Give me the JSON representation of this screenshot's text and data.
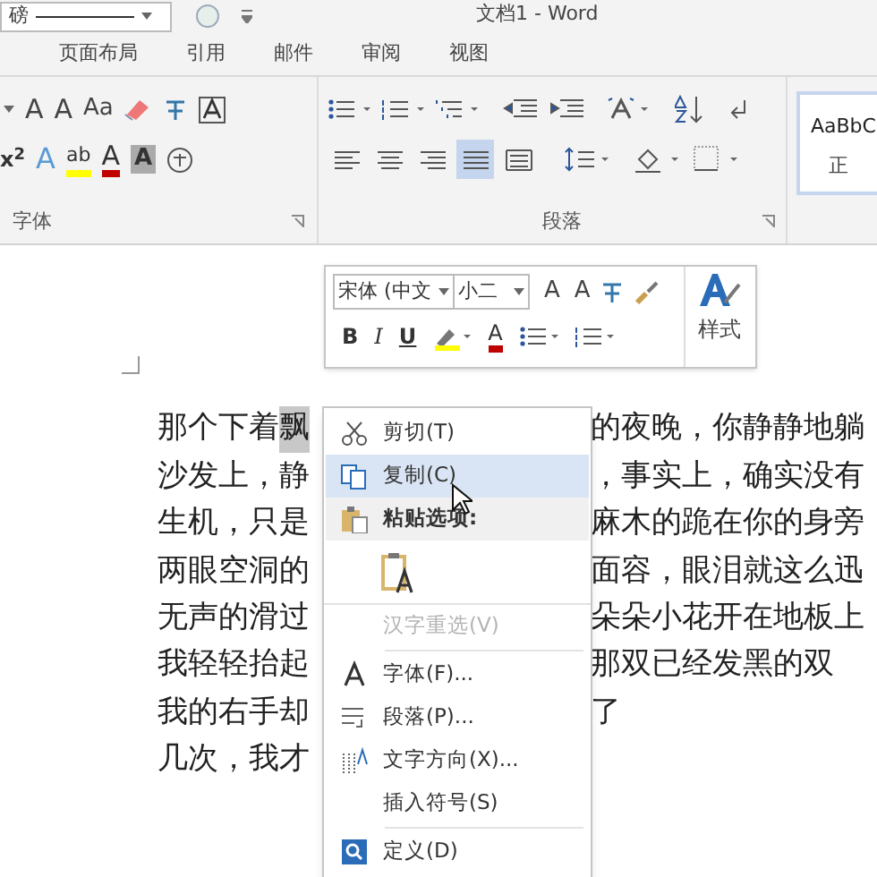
{
  "title_bar": {
    "font_size_box": "磅",
    "title": "文档1 - Word"
  },
  "tabs": [
    {
      "label": "页面布局",
      "selected": false
    },
    {
      "label": "引用",
      "selected": false
    },
    {
      "label": "邮件",
      "selected": false
    },
    {
      "label": "审阅",
      "selected": false
    },
    {
      "label": "视图",
      "selected": false
    }
  ],
  "font_group": {
    "label": "字体",
    "row1": [
      "A",
      "A",
      "Aa"
    ],
    "row2": [
      "x$^{2}$",
      "A",
      "ab",
      "A",
      "A"
    ]
  },
  "paragraph_group": {
    "label": "段落",
    "alignment": [
      {
        "selected": false
      },
      {
        "selected": false
      },
      {
        "selected": false
      },
      {
        "selected": true
      },
      {
        "selected": false
      }
    ]
  },
  "styles": {
    "preview": "AaBbC",
    "name": "正"
  },
  "mini_toolbar": {
    "font": "宋体 (中文",
    "size": "小二",
    "row1": [
      "A",
      "A"
    ],
    "row2": [
      "B",
      "I",
      "U",
      "A"
    ],
    "styles_label": "样式"
  },
  "document_lines": [
    {
      "left": "那个下着",
      "selected_text": "飘",
      "right": "的夜晚，你静静地躺"
    },
    {
      "left": "沙发上，静",
      "right": "，事实上，确实没有"
    },
    {
      "left": "生机，只是",
      "right": "麻木的跪在你的身旁"
    },
    {
      "left": "两眼空洞的",
      "right": "面容，眼泪就这么迅"
    },
    {
      "left": "无声的滑过",
      "right": "朵朵小花开在地板上"
    },
    {
      "left": "我轻轻抬起",
      "right": "那双已经发黑的双"
    },
    {
      "left": "我的右手却",
      "right": "了"
    },
    {
      "left": "几次，我才"
    }
  ],
  "context_menu": [
    {
      "kind": "item",
      "label": "剪切(T)",
      "highlighted": false,
      "disabled": false
    },
    {
      "kind": "item",
      "label": "复制(C)",
      "highlighted": true,
      "disabled": false
    },
    {
      "kind": "header",
      "label": "粘贴选项:",
      "highlighted": false,
      "disabled": false
    },
    {
      "kind": "paste"
    },
    {
      "kind": "item",
      "label": "汉字重选(V)",
      "highlighted": false,
      "disabled": true
    },
    {
      "kind": "separator"
    },
    {
      "kind": "item",
      "label": "字体(F)...",
      "highlighted": false,
      "disabled": false
    },
    {
      "kind": "item",
      "label": "段落(P)...",
      "highlighted": false,
      "disabled": false
    },
    {
      "kind": "item",
      "label": "文字方向(X)...",
      "highlighted": false,
      "disabled": false
    },
    {
      "kind": "item",
      "label": "插入符号(S)",
      "highlighted": false,
      "disabled": false
    },
    {
      "kind": "separator"
    },
    {
      "kind": "item",
      "label": "定义(D)",
      "highlighted": false,
      "disabled": false
    }
  ]
}
